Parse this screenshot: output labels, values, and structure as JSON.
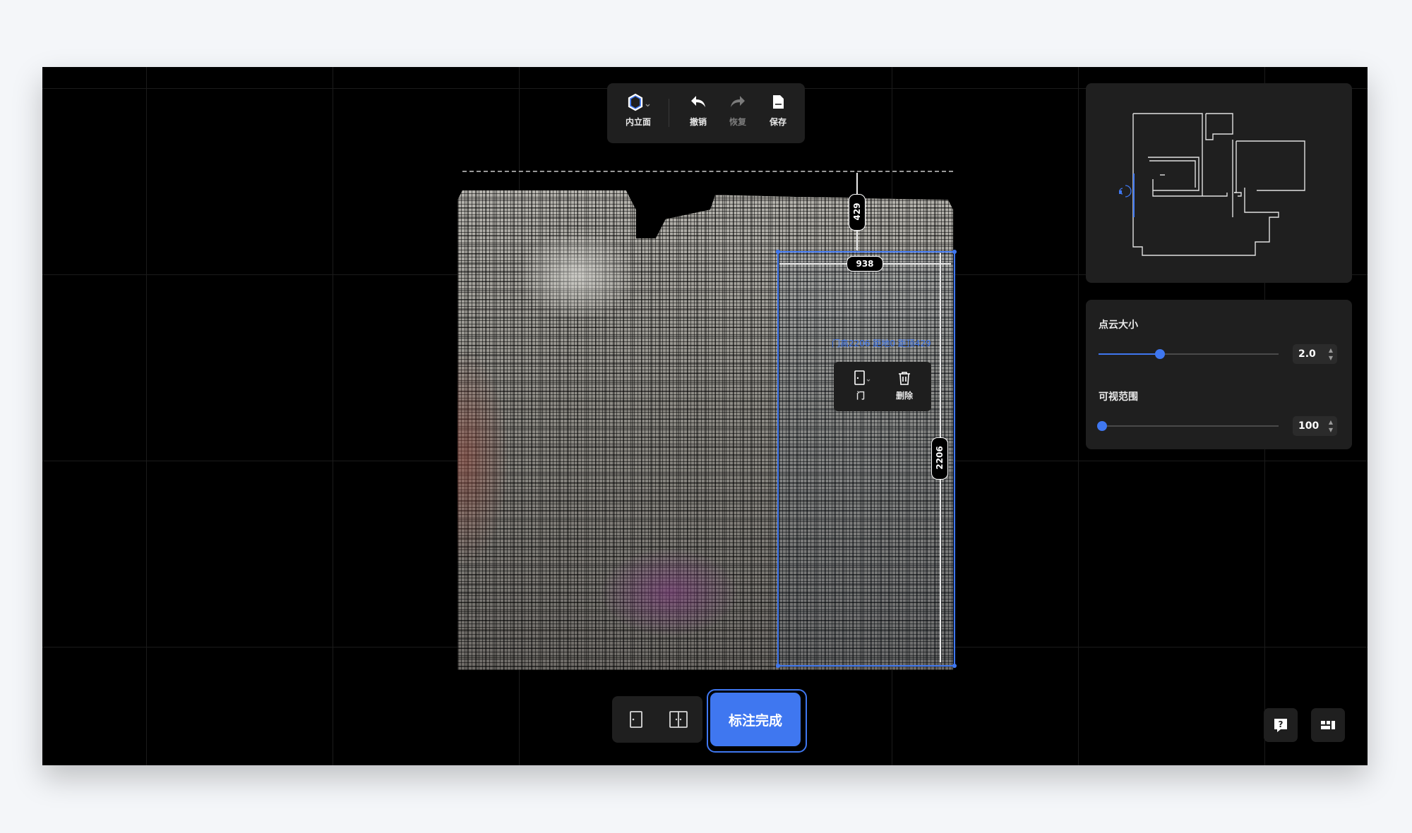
{
  "toolbar": {
    "view_mode_label": "内立面",
    "undo_label": "撤销",
    "redo_label": "恢复",
    "save_label": "保存",
    "icons": [
      "hexagon-icon",
      "undo-icon",
      "redo-icon",
      "save-icon"
    ]
  },
  "canvas": {
    "dim_top": "429",
    "dim_width": "938",
    "dim_height": "2206",
    "selection_info": "门高2206 距地0 距顶429",
    "context_menu": {
      "door_label": "门",
      "delete_label": "删除"
    }
  },
  "bottom": {
    "finish_label": "标注完成",
    "tools": [
      "single-door-tool-icon",
      "double-door-tool-icon"
    ]
  },
  "settings": {
    "point_size_label": "点云大小",
    "point_size_value": "2.0",
    "point_size_level": 0.34,
    "view_range_label": "可视范围",
    "view_range_value": "100",
    "view_range_level": 0.02
  },
  "colors": {
    "accent": "#3f77f0",
    "panel": "#1f1f1f",
    "canvas": "#000000"
  }
}
